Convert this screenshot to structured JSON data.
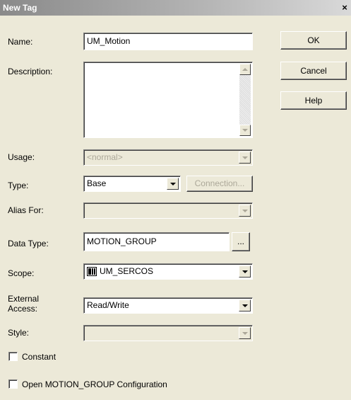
{
  "window": {
    "title": "New Tag",
    "close_glyph": "×"
  },
  "buttons": {
    "ok": "OK",
    "cancel": "Cancel",
    "help": "Help",
    "connection": "Connection...",
    "browse": "..."
  },
  "form": {
    "name": {
      "label": "Name:",
      "value": "UM_Motion"
    },
    "description": {
      "label": "Description:",
      "value": ""
    },
    "usage": {
      "label": "Usage:",
      "value": "<normal>"
    },
    "type": {
      "label": "Type:",
      "value": "Base"
    },
    "alias_for": {
      "label": "Alias For:",
      "value": ""
    },
    "data_type": {
      "label": "Data Type:",
      "value": "MOTION_GROUP"
    },
    "scope": {
      "label": "Scope:",
      "value": "UM_SERCOS",
      "icon": "controller-icon"
    },
    "external_access": {
      "label_line1": "External",
      "label_line2": "Access:",
      "value": "Read/Write"
    },
    "style": {
      "label": "Style:",
      "value": ""
    }
  },
  "checkboxes": {
    "constant": {
      "label": "Constant",
      "checked": false
    },
    "open_config": {
      "label": "Open MOTION_GROUP Configuration",
      "checked": false
    }
  }
}
